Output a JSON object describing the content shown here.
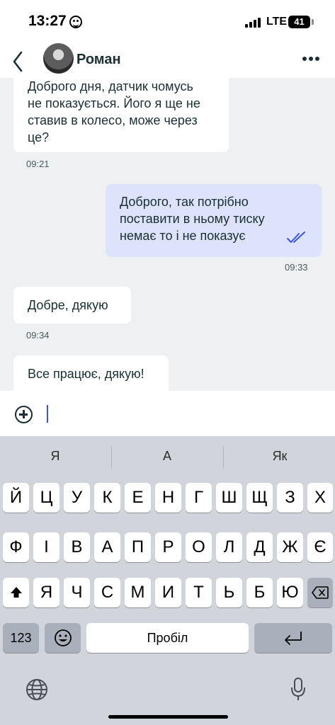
{
  "status_bar": {
    "time": "13:27",
    "network": "LTE",
    "battery": "41"
  },
  "header": {
    "contact_name": "Роман"
  },
  "messages": [
    {
      "direction": "in",
      "lines": [
        "Доброго дня, датчик чомусь",
        "не показується. Його я ще не",
        "ставив в колесо, може через",
        "це?"
      ],
      "time": "09:21"
    },
    {
      "direction": "out",
      "lines": [
        "Доброго, так потрібно",
        "поставити в ньому тиску",
        "немає то і не показує"
      ],
      "time": "09:33"
    },
    {
      "direction": "in",
      "lines": [
        "Добре, дякую"
      ],
      "time": "09:34"
    },
    {
      "direction": "in",
      "lines": [
        "Все працює, дякую!"
      ]
    }
  ],
  "keyboard": {
    "suggestions": [
      "Я",
      "А",
      "Як"
    ],
    "row1": [
      "Й",
      "Ц",
      "У",
      "К",
      "Е",
      "Н",
      "Г",
      "Ш",
      "Щ",
      "З",
      "Х"
    ],
    "row2": [
      "Ф",
      "І",
      "В",
      "А",
      "П",
      "Р",
      "О",
      "Л",
      "Д",
      "Ж",
      "Є"
    ],
    "row3": [
      "Я",
      "Ч",
      "С",
      "М",
      "И",
      "Т",
      "Ь",
      "Б",
      "Ю"
    ],
    "numbers_label": "123",
    "space_label": "Пробіл"
  },
  "colors": {
    "accent": "#3a55d9",
    "outgoing_bubble": "#dce3fb",
    "background": "#eff0f2"
  }
}
